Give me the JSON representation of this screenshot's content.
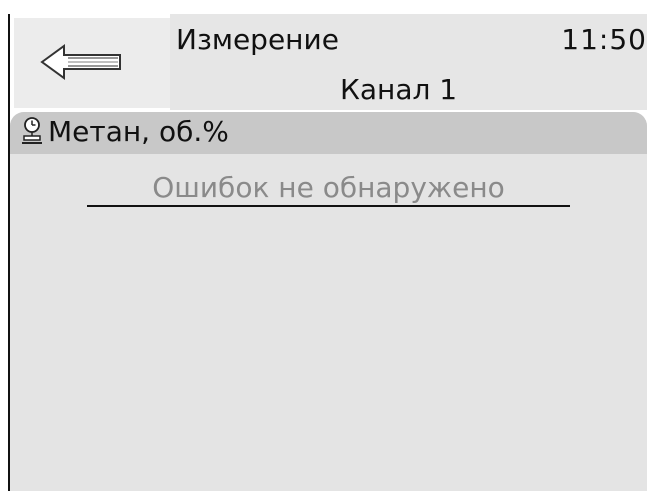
{
  "header": {
    "title": "Измерение",
    "time": "11:50",
    "subtitle": "Канал 1",
    "back_icon": "arrow-left-icon"
  },
  "sensor": {
    "icon": "clock-sensor-icon",
    "label": "Метан, об.%"
  },
  "status": {
    "message": "Ошибок не обнаружено"
  },
  "colors": {
    "header_background": "#e6e6e6",
    "panel_background": "#e4e4e4",
    "panel_header_background": "#c8c8c8",
    "status_text": "#8a8a8a"
  }
}
